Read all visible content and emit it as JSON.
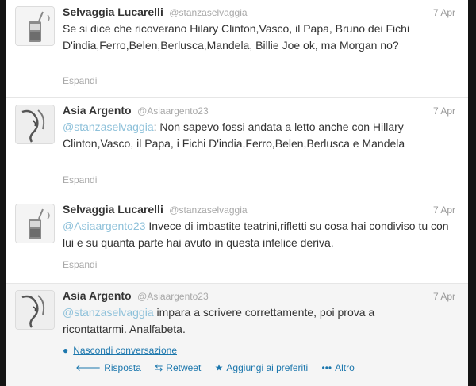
{
  "tweets": [
    {
      "name": "Selvaggia Lucarelli",
      "handle": "@stanzaselvaggia",
      "time": "7 Apr",
      "text": "Se si dice che ricoverano Hilary Clinton,Vasco, il Papa, Bruno dei Fichi D'india,Ferro,Belen,Berlusca,Mandela, Billie Joe ok, ma Morgan no?",
      "expand": "Espandi"
    },
    {
      "name": "Asia Argento",
      "handle": "@Asiaargento23",
      "time": "7 Apr",
      "mention": "@stanzaselvaggia",
      "text": ": Non sapevo fossi andata a letto anche con Hillary Clinton,Vasco, il Papa, i Fichi D'india,Ferro,Belen,Berlusca e Mandela",
      "expand": "Espandi"
    },
    {
      "name": "Selvaggia Lucarelli",
      "handle": "@stanzaselvaggia",
      "time": "7 Apr",
      "mention": "@Asiaargento23",
      "text": " Invece di imbastite teatrini,rifletti su cosa hai condiviso tu con lui e su quanta parte hai avuto in questa infelice deriva.",
      "expand": "Espandi"
    },
    {
      "name": "Asia Argento",
      "handle": "@Asiaargento23",
      "time": "7 Apr",
      "mention": "@stanzaselvaggia",
      "text": " impara a scrivere correttamente, poi prova a ricontattarmi. Analfabeta.",
      "hide_conversation": "Nascondi conversazione",
      "actions": {
        "reply": "Risposta",
        "retweet": "Retweet",
        "favorite": "Aggiungi ai preferiti",
        "more": "Altro"
      }
    }
  ],
  "icons": {
    "avatar_selvaggia": "phone-icon",
    "avatar_asia": "portrait-icon",
    "reply": "reply-arrow-icon",
    "retweet": "retweet-icon",
    "favorite": "star-icon",
    "more": "more-dots-icon",
    "conversation": "speech-bubble-icon"
  },
  "colors": {
    "link": "#1c77ad",
    "mention": "#8ec1da",
    "meta": "#a8a8a8",
    "text": "#333333"
  }
}
